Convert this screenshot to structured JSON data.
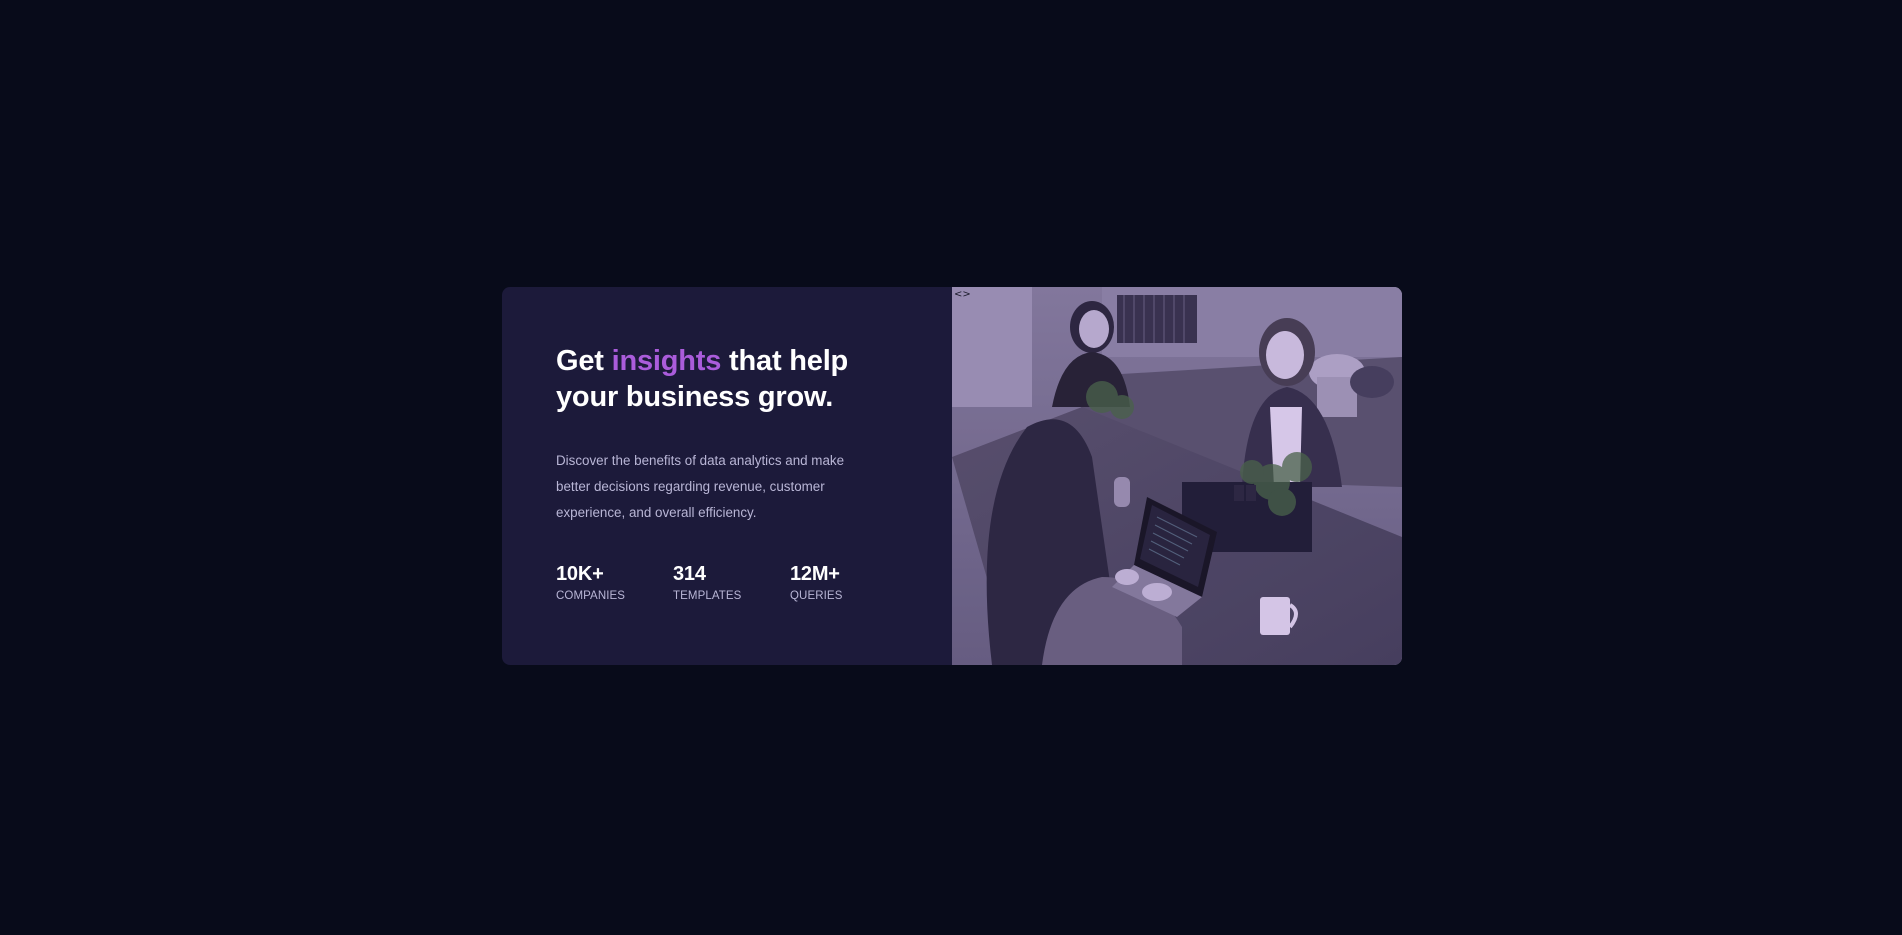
{
  "card": {
    "headline": {
      "prefix": "Get ",
      "accent": "insights",
      "suffix": " that help your business grow."
    },
    "description": "Discover the benefits of data analytics and make better decisions regarding revenue, customer experience, and overall efficiency.",
    "stats": [
      {
        "value": "10K+",
        "label": "Companies"
      },
      {
        "value": "314",
        "label": "Templates"
      },
      {
        "value": "12M+",
        "label": "Queries"
      }
    ]
  },
  "colors": {
    "page_background": "#080b1a",
    "card_background": "#1c1a3a",
    "accent": "#aa5cdb",
    "main_text": "#ffffff",
    "secondary_text": "#b9b6d6"
  },
  "icons": {
    "image_placeholder": "broken-image-icon"
  }
}
